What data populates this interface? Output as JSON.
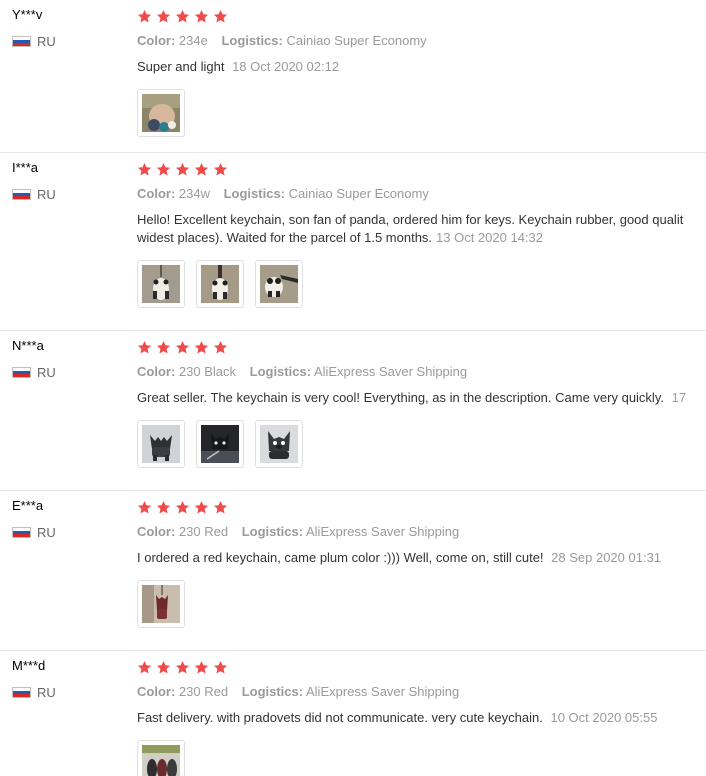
{
  "labels": {
    "color": "Color:",
    "logistics": "Logistics:"
  },
  "star_color": "#ef4b4b",
  "reviews": [
    {
      "user": "Y***v",
      "country": "RU",
      "rating": 5,
      "color": "234e",
      "logistics": "Cainiao Super Economy",
      "text": "Super and light",
      "date": "18 Oct 2020 02:12",
      "photo_count": 1
    },
    {
      "user": "I***a",
      "country": "RU",
      "rating": 5,
      "color": "234w",
      "logistics": "Cainiao Super Economy",
      "text_line1": "Hello! Excellent keychain, son fan of panda, ordered him for keys. Keychain rubber, good qualit",
      "text_line2": "widest places). Waited for the parcel of 1.5 months.",
      "date": "13 Oct 2020 14:32",
      "photo_count": 3
    },
    {
      "user": "N***a",
      "country": "RU",
      "rating": 5,
      "color": "230 Black",
      "logistics": "AliExpress Saver Shipping",
      "text": "Great seller. The keychain is very cool! Everything, as in the description. Came very quickly.",
      "date": "17",
      "photo_count": 3
    },
    {
      "user": "E***a",
      "country": "RU",
      "rating": 5,
      "color": "230 Red",
      "logistics": "AliExpress Saver Shipping",
      "text": "I ordered a red keychain, came plum color :))) Well, come on, still cute!",
      "date": "28 Sep 2020 01:31",
      "photo_count": 1
    },
    {
      "user": "M***d",
      "country": "RU",
      "rating": 5,
      "color": "230 Red",
      "logistics": "AliExpress Saver Shipping",
      "text": "Fast delivery. with pradovets did not communicate. very cute keychain.",
      "date": "10 Oct 2020 05:55",
      "photo_count": 1
    }
  ]
}
